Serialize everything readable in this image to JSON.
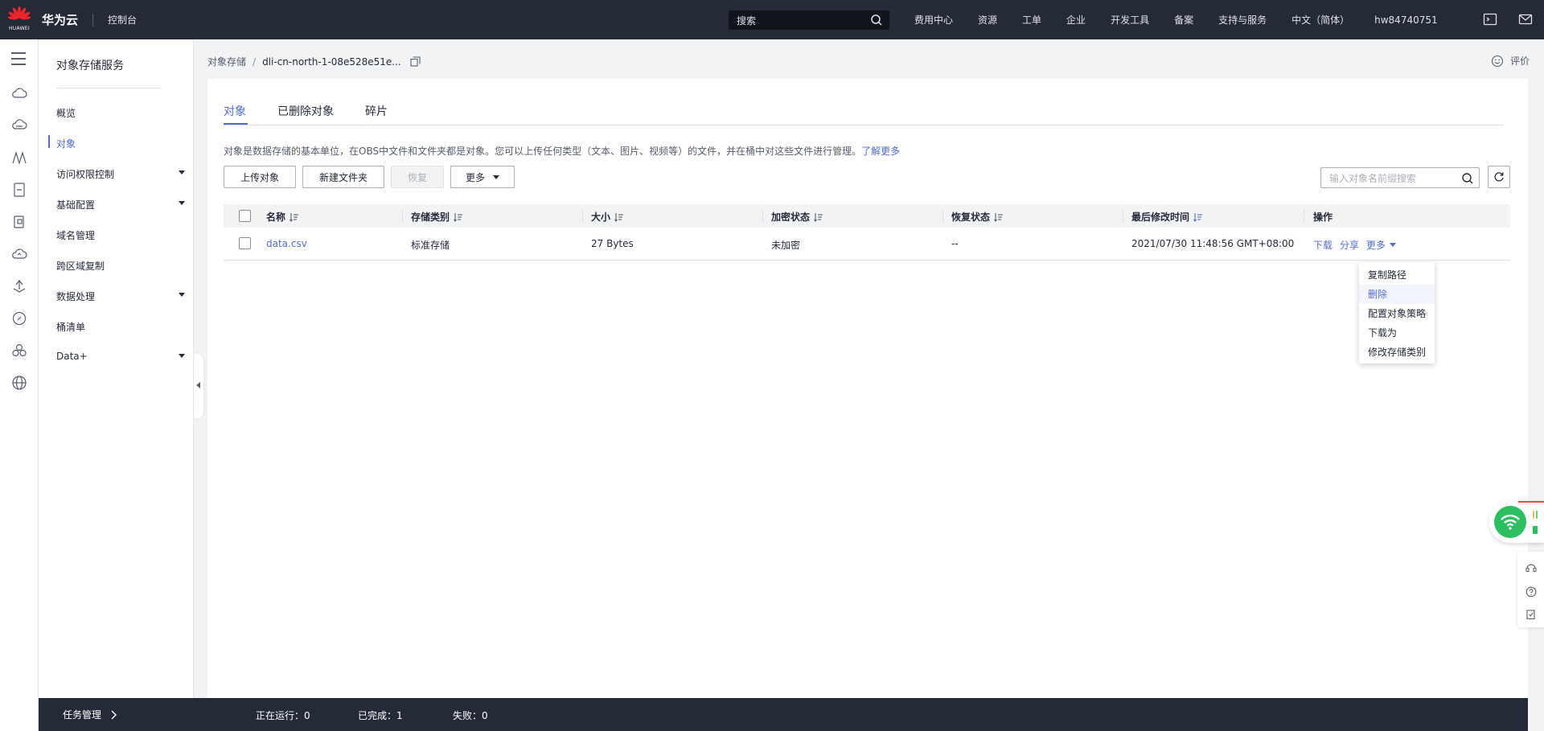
{
  "header": {
    "logo_text": "HUAWEI",
    "brand": "华为云",
    "console": "控制台",
    "search_placeholder": "搜索",
    "nav": [
      "费用中心",
      "资源",
      "工单",
      "企业",
      "开发工具",
      "备案",
      "支持与服务",
      "中文（简体）",
      "hw84740751"
    ],
    "icons": [
      "terminal-icon",
      "mail-icon"
    ]
  },
  "rail": {
    "icons": [
      "menu-icon",
      "cloud-icon",
      "cloud-server-icon",
      "network-icon",
      "storage-icon",
      "database-icon",
      "cloud-upload-icon",
      "deploy-icon",
      "compass-icon",
      "cluster-icon",
      "globe-icon"
    ]
  },
  "sidebar": {
    "service_title": "对象存储服务",
    "items": [
      {
        "label": "概览",
        "active": false,
        "expandable": false
      },
      {
        "label": "对象",
        "active": true,
        "expandable": false
      },
      {
        "label": "访问权限控制",
        "active": false,
        "expandable": true
      },
      {
        "label": "基础配置",
        "active": false,
        "expandable": true
      },
      {
        "label": "域名管理",
        "active": false,
        "expandable": false
      },
      {
        "label": "跨区域复制",
        "active": false,
        "expandable": false
      },
      {
        "label": "数据处理",
        "active": false,
        "expandable": true
      },
      {
        "label": "桶清单",
        "active": false,
        "expandable": false
      },
      {
        "label": "Data+",
        "active": false,
        "expandable": true
      }
    ]
  },
  "breadcrumb": {
    "root": "对象存储",
    "separator": "/",
    "current": "dli-cn-north-1-08e528e51e..."
  },
  "feedback": "评价",
  "tabs": [
    {
      "label": "对象",
      "active": true
    },
    {
      "label": "已删除对象",
      "active": false
    },
    {
      "label": "碎片",
      "active": false
    }
  ],
  "description": {
    "text": "对象是数据存储的基本单位，在OBS中文件和文件夹都是对象。您可以上传任何类型（文本、图片、视频等）的文件，并在桶中对这些文件进行管理。",
    "link": "了解更多"
  },
  "toolbar": {
    "upload": "上传对象",
    "new_folder": "新建文件夹",
    "restore": "恢复",
    "more": "更多",
    "search_placeholder": "输入对象名前缀搜索"
  },
  "table": {
    "columns": [
      "名称",
      "存储类别",
      "大小",
      "加密状态",
      "恢复状态",
      "最后修改时间",
      "操作"
    ],
    "rows": [
      {
        "name": "data.csv",
        "storage_class": "标准存储",
        "size": "27 Bytes",
        "encryption": "未加密",
        "restore": "--",
        "modified": "2021/07/30 11:48:56 GMT+08:00",
        "actions": [
          "下载",
          "分享",
          "更多"
        ]
      }
    ]
  },
  "dropdown": {
    "items": [
      "复制路径",
      "删除",
      "配置对象策略",
      "下载为",
      "修改存储类别"
    ],
    "hovered": "删除"
  },
  "taskbar": {
    "title": "任务管理",
    "running_label": "正在运行：",
    "running": "0",
    "done_label": "已完成：",
    "done": "1",
    "failed_label": "失败：",
    "failed": "0"
  },
  "colors": {
    "topbar": "#252a37",
    "accent": "#526ecc",
    "wifi": "#2dbe60"
  }
}
